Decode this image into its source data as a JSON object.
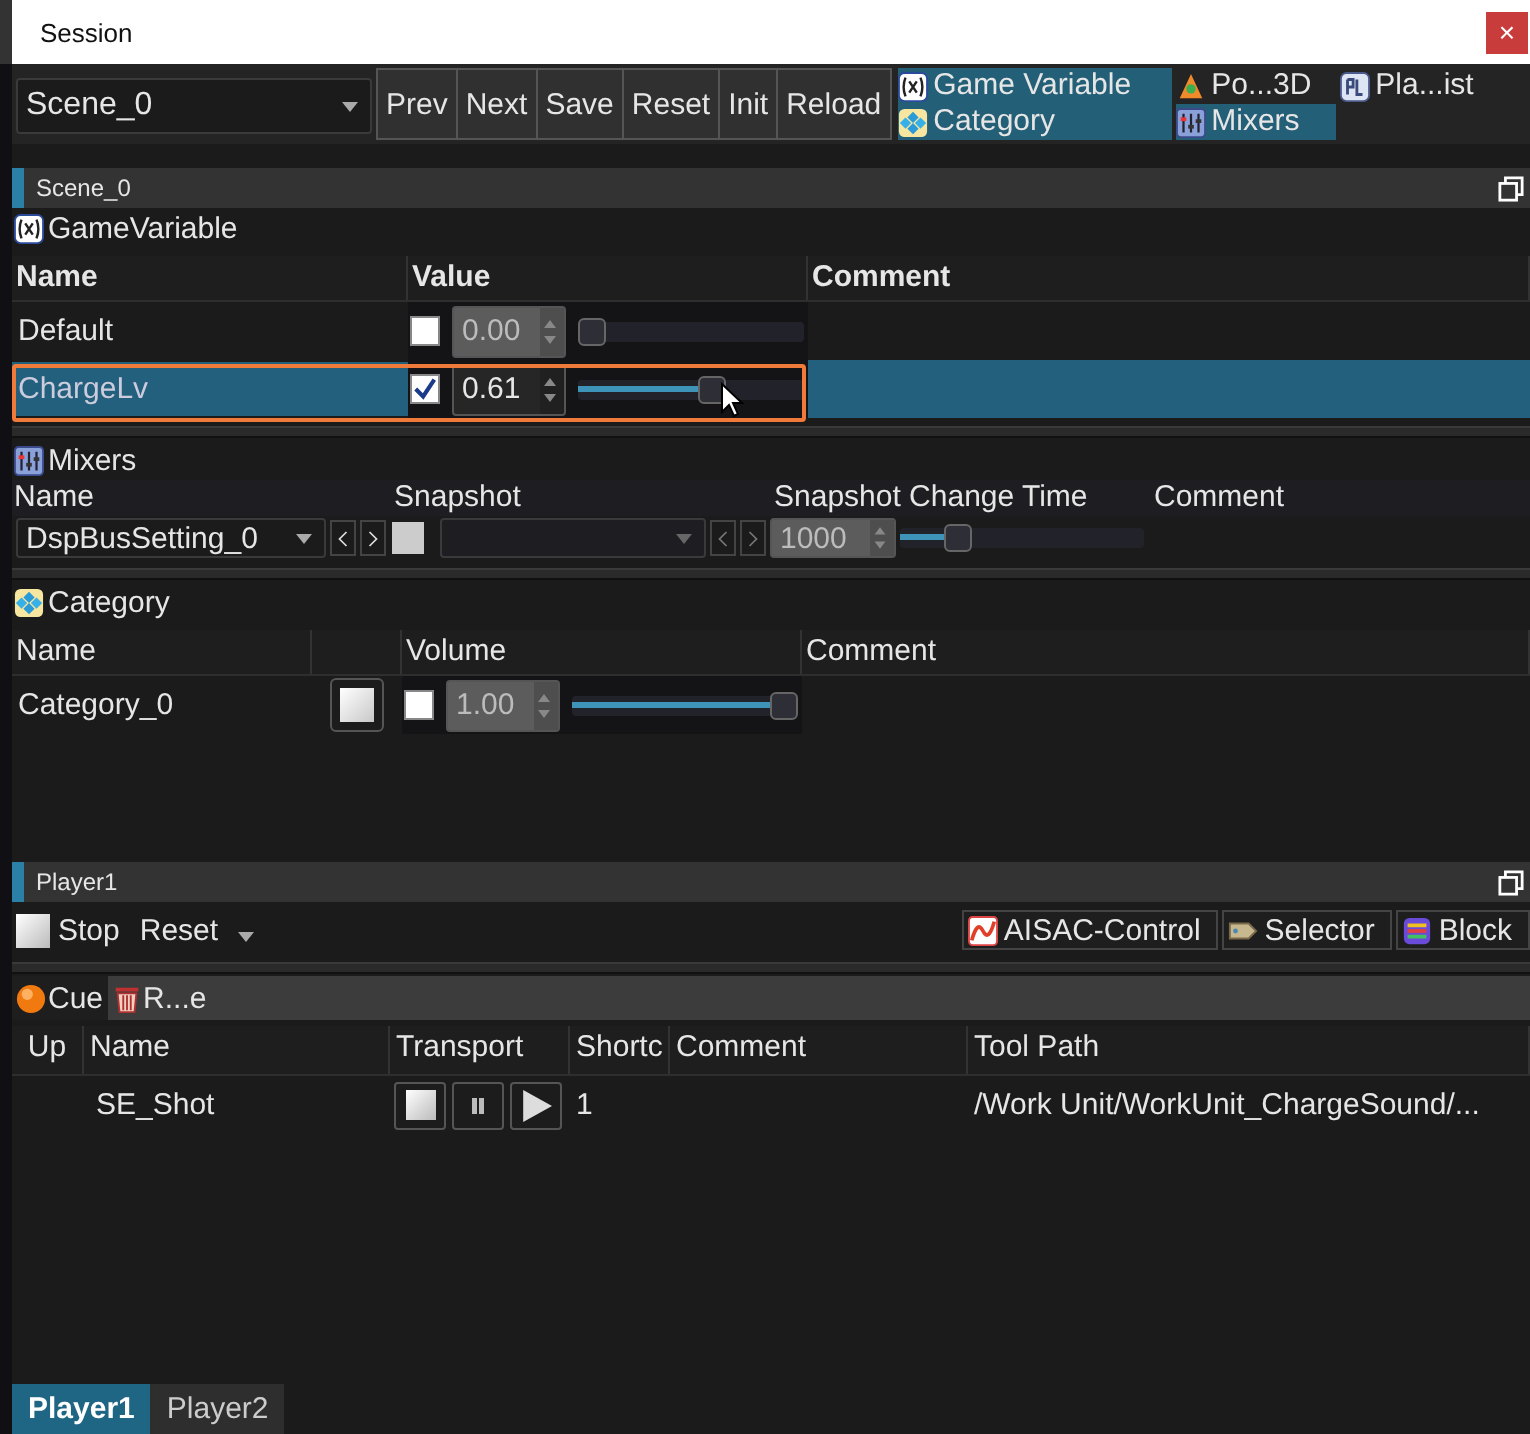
{
  "window": {
    "title": "Session",
    "close": "×"
  },
  "toolbar": {
    "scene": "Scene_0",
    "buttons": [
      "Prev",
      "Next",
      "Save",
      "Reset",
      "Init",
      "Reload"
    ],
    "tool_tabs": [
      {
        "label": "Game Variable",
        "selected": true,
        "kind": "variable"
      },
      {
        "label": "Po...3D",
        "selected": false,
        "kind": "pos3d"
      },
      {
        "label": "Pla...ist",
        "selected": false,
        "kind": "playlist"
      },
      {
        "label": "Category",
        "selected": true,
        "kind": "category"
      },
      {
        "label": "Mixers",
        "selected": true,
        "kind": "mixers"
      }
    ]
  },
  "scene_panel": {
    "title": "Scene_0",
    "game_variable": {
      "title": "GameVariable",
      "columns": [
        "Name",
        "Value",
        "Comment"
      ],
      "rows": [
        {
          "name": "Default",
          "checked": false,
          "value": "0.00",
          "level": 0,
          "selected": false,
          "highlighted": false
        },
        {
          "name": "ChargeLv",
          "checked": true,
          "value": "0.61",
          "level": 0.61,
          "selected": true,
          "highlighted": true
        }
      ]
    },
    "mixers": {
      "title": "Mixers",
      "columns": [
        "Name",
        "Snapshot",
        "Snapshot Change Time",
        "Comment"
      ],
      "rows": [
        {
          "name": "DspBusSetting_0",
          "time": "1000",
          "level": 0.2
        }
      ]
    },
    "category": {
      "title": "Category",
      "columns": [
        "Name",
        "Volume",
        "Comment"
      ],
      "rows": [
        {
          "name": "Category_0",
          "checked": false,
          "value": "1.00",
          "level": 1
        }
      ]
    }
  },
  "player_panel": {
    "title": "Player1",
    "stop": "Stop",
    "reset": "Reset",
    "tools": [
      {
        "label": "AISAC-Control",
        "kind": "aisac"
      },
      {
        "label": "Selector",
        "kind": "selector"
      },
      {
        "label": "Block",
        "kind": "block"
      }
    ],
    "tabs": [
      {
        "label": "Cue",
        "selected": true,
        "kind": "cue"
      },
      {
        "label": "R...e",
        "selected": false,
        "kind": "trash"
      }
    ],
    "columns": [
      "Up",
      "Name",
      "Transport",
      "Shortc",
      "Comment",
      "Tool Path"
    ],
    "rows": [
      {
        "name": "SE_Shot",
        "shortcut": "1",
        "tool_path": "/Work Unit/WorkUnit_ChargeSound/..."
      }
    ]
  },
  "bottom_tabs": [
    {
      "label": "Player1",
      "selected": true
    },
    {
      "label": "Player2",
      "selected": false
    }
  ]
}
